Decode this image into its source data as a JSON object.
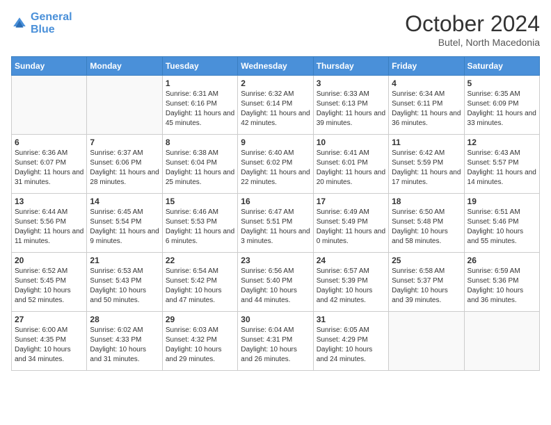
{
  "header": {
    "logo_line1": "General",
    "logo_line2": "Blue",
    "month": "October 2024",
    "location": "Butel, North Macedonia"
  },
  "days_of_week": [
    "Sunday",
    "Monday",
    "Tuesday",
    "Wednesday",
    "Thursday",
    "Friday",
    "Saturday"
  ],
  "weeks": [
    [
      {
        "day": "",
        "info": ""
      },
      {
        "day": "",
        "info": ""
      },
      {
        "day": "1",
        "info": "Sunrise: 6:31 AM\nSunset: 6:16 PM\nDaylight: 11 hours and 45 minutes."
      },
      {
        "day": "2",
        "info": "Sunrise: 6:32 AM\nSunset: 6:14 PM\nDaylight: 11 hours and 42 minutes."
      },
      {
        "day": "3",
        "info": "Sunrise: 6:33 AM\nSunset: 6:13 PM\nDaylight: 11 hours and 39 minutes."
      },
      {
        "day": "4",
        "info": "Sunrise: 6:34 AM\nSunset: 6:11 PM\nDaylight: 11 hours and 36 minutes."
      },
      {
        "day": "5",
        "info": "Sunrise: 6:35 AM\nSunset: 6:09 PM\nDaylight: 11 hours and 33 minutes."
      }
    ],
    [
      {
        "day": "6",
        "info": "Sunrise: 6:36 AM\nSunset: 6:07 PM\nDaylight: 11 hours and 31 minutes."
      },
      {
        "day": "7",
        "info": "Sunrise: 6:37 AM\nSunset: 6:06 PM\nDaylight: 11 hours and 28 minutes."
      },
      {
        "day": "8",
        "info": "Sunrise: 6:38 AM\nSunset: 6:04 PM\nDaylight: 11 hours and 25 minutes."
      },
      {
        "day": "9",
        "info": "Sunrise: 6:40 AM\nSunset: 6:02 PM\nDaylight: 11 hours and 22 minutes."
      },
      {
        "day": "10",
        "info": "Sunrise: 6:41 AM\nSunset: 6:01 PM\nDaylight: 11 hours and 20 minutes."
      },
      {
        "day": "11",
        "info": "Sunrise: 6:42 AM\nSunset: 5:59 PM\nDaylight: 11 hours and 17 minutes."
      },
      {
        "day": "12",
        "info": "Sunrise: 6:43 AM\nSunset: 5:57 PM\nDaylight: 11 hours and 14 minutes."
      }
    ],
    [
      {
        "day": "13",
        "info": "Sunrise: 6:44 AM\nSunset: 5:56 PM\nDaylight: 11 hours and 11 minutes."
      },
      {
        "day": "14",
        "info": "Sunrise: 6:45 AM\nSunset: 5:54 PM\nDaylight: 11 hours and 9 minutes."
      },
      {
        "day": "15",
        "info": "Sunrise: 6:46 AM\nSunset: 5:53 PM\nDaylight: 11 hours and 6 minutes."
      },
      {
        "day": "16",
        "info": "Sunrise: 6:47 AM\nSunset: 5:51 PM\nDaylight: 11 hours and 3 minutes."
      },
      {
        "day": "17",
        "info": "Sunrise: 6:49 AM\nSunset: 5:49 PM\nDaylight: 11 hours and 0 minutes."
      },
      {
        "day": "18",
        "info": "Sunrise: 6:50 AM\nSunset: 5:48 PM\nDaylight: 10 hours and 58 minutes."
      },
      {
        "day": "19",
        "info": "Sunrise: 6:51 AM\nSunset: 5:46 PM\nDaylight: 10 hours and 55 minutes."
      }
    ],
    [
      {
        "day": "20",
        "info": "Sunrise: 6:52 AM\nSunset: 5:45 PM\nDaylight: 10 hours and 52 minutes."
      },
      {
        "day": "21",
        "info": "Sunrise: 6:53 AM\nSunset: 5:43 PM\nDaylight: 10 hours and 50 minutes."
      },
      {
        "day": "22",
        "info": "Sunrise: 6:54 AM\nSunset: 5:42 PM\nDaylight: 10 hours and 47 minutes."
      },
      {
        "day": "23",
        "info": "Sunrise: 6:56 AM\nSunset: 5:40 PM\nDaylight: 10 hours and 44 minutes."
      },
      {
        "day": "24",
        "info": "Sunrise: 6:57 AM\nSunset: 5:39 PM\nDaylight: 10 hours and 42 minutes."
      },
      {
        "day": "25",
        "info": "Sunrise: 6:58 AM\nSunset: 5:37 PM\nDaylight: 10 hours and 39 minutes."
      },
      {
        "day": "26",
        "info": "Sunrise: 6:59 AM\nSunset: 5:36 PM\nDaylight: 10 hours and 36 minutes."
      }
    ],
    [
      {
        "day": "27",
        "info": "Sunrise: 6:00 AM\nSunset: 4:35 PM\nDaylight: 10 hours and 34 minutes."
      },
      {
        "day": "28",
        "info": "Sunrise: 6:02 AM\nSunset: 4:33 PM\nDaylight: 10 hours and 31 minutes."
      },
      {
        "day": "29",
        "info": "Sunrise: 6:03 AM\nSunset: 4:32 PM\nDaylight: 10 hours and 29 minutes."
      },
      {
        "day": "30",
        "info": "Sunrise: 6:04 AM\nSunset: 4:31 PM\nDaylight: 10 hours and 26 minutes."
      },
      {
        "day": "31",
        "info": "Sunrise: 6:05 AM\nSunset: 4:29 PM\nDaylight: 10 hours and 24 minutes."
      },
      {
        "day": "",
        "info": ""
      },
      {
        "day": "",
        "info": ""
      }
    ]
  ]
}
